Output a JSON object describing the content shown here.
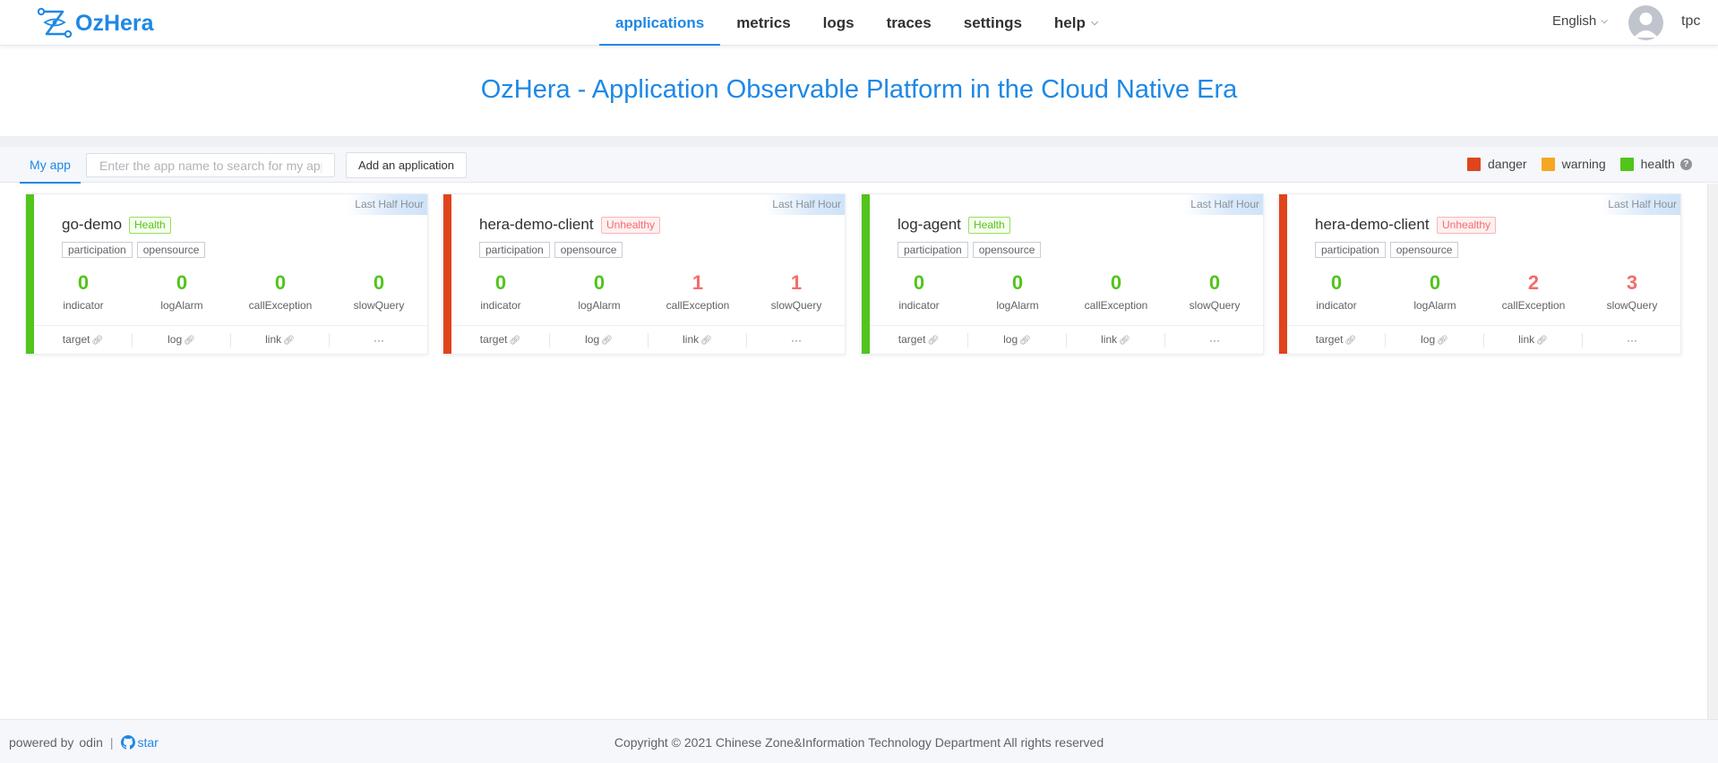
{
  "brand": {
    "name": "OzHera"
  },
  "nav": {
    "items": [
      {
        "label": "applications",
        "active": true
      },
      {
        "label": "metrics",
        "active": false
      },
      {
        "label": "logs",
        "active": false
      },
      {
        "label": "traces",
        "active": false
      },
      {
        "label": "settings",
        "active": false
      },
      {
        "label": "help",
        "active": false,
        "dropdown": true
      }
    ],
    "language": "English",
    "user": "tpc"
  },
  "hero": {
    "title": "OzHera - Application Observable Platform in the Cloud Native Era"
  },
  "toolbar": {
    "tab": "My app",
    "search_placeholder": "Enter the app name to search for my app",
    "add_button": "Add an application",
    "legend": [
      {
        "label": "danger",
        "color": "#e0441c"
      },
      {
        "label": "warning",
        "color": "#f5a623"
      },
      {
        "label": "health",
        "color": "#52c41a"
      }
    ],
    "help_icon": "question-circle-icon"
  },
  "cards": [
    {
      "name": "go-demo",
      "status": "Health",
      "status_type": "ok",
      "stripe_color": "#52c41a",
      "period": "Last Half Hour",
      "tags": [
        "participation",
        "opensource"
      ],
      "metrics": [
        {
          "value": "0",
          "label": "indicator",
          "tone": "green"
        },
        {
          "value": "0",
          "label": "logAlarm",
          "tone": "green"
        },
        {
          "value": "0",
          "label": "callException",
          "tone": "green"
        },
        {
          "value": "0",
          "label": "slowQuery",
          "tone": "green"
        }
      ],
      "links": [
        "target",
        "log",
        "link",
        "···"
      ]
    },
    {
      "name": "hera-demo-client",
      "status": "Unhealthy",
      "status_type": "bad",
      "stripe_color": "#e0441c",
      "period": "Last Half Hour",
      "tags": [
        "participation",
        "opensource"
      ],
      "metrics": [
        {
          "value": "0",
          "label": "indicator",
          "tone": "green"
        },
        {
          "value": "0",
          "label": "logAlarm",
          "tone": "green"
        },
        {
          "value": "1",
          "label": "callException",
          "tone": "red"
        },
        {
          "value": "1",
          "label": "slowQuery",
          "tone": "red"
        }
      ],
      "links": [
        "target",
        "log",
        "link",
        "···"
      ]
    },
    {
      "name": "log-agent",
      "status": "Health",
      "status_type": "ok",
      "stripe_color": "#52c41a",
      "period": "Last Half Hour",
      "tags": [
        "participation",
        "opensource"
      ],
      "metrics": [
        {
          "value": "0",
          "label": "indicator",
          "tone": "green"
        },
        {
          "value": "0",
          "label": "logAlarm",
          "tone": "green"
        },
        {
          "value": "0",
          "label": "callException",
          "tone": "green"
        },
        {
          "value": "0",
          "label": "slowQuery",
          "tone": "green"
        }
      ],
      "links": [
        "target",
        "log",
        "link",
        "···"
      ]
    },
    {
      "name": "hera-demo-client",
      "status": "Unhealthy",
      "status_type": "bad",
      "stripe_color": "#e0441c",
      "period": "Last Half Hour",
      "tags": [
        "participation",
        "opensource"
      ],
      "metrics": [
        {
          "value": "0",
          "label": "indicator",
          "tone": "green"
        },
        {
          "value": "0",
          "label": "logAlarm",
          "tone": "green"
        },
        {
          "value": "2",
          "label": "callException",
          "tone": "red"
        },
        {
          "value": "3",
          "label": "slowQuery",
          "tone": "red"
        }
      ],
      "links": [
        "target",
        "log",
        "link",
        "···"
      ]
    }
  ],
  "footer": {
    "powered_by": "powered by",
    "powered_name": "odin",
    "star": "star",
    "copyright": "Copyright © 2021 Chinese Zone&Information Technology Department All rights reserved"
  }
}
